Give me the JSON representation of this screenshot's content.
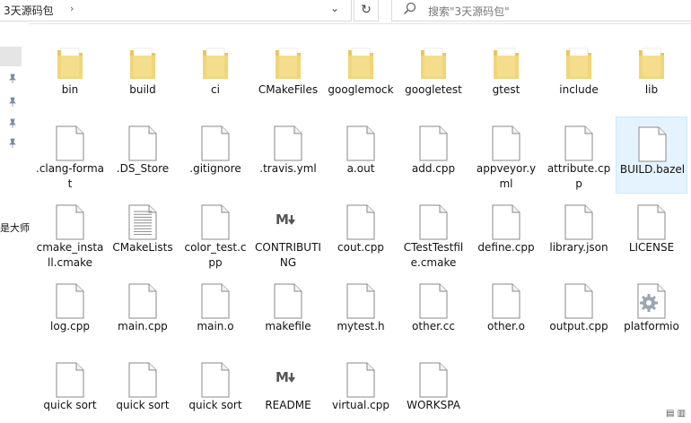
{
  "address_bar": {
    "path": "3天源码包",
    "refresh_glyph": "↻"
  },
  "search": {
    "placeholder": "搜索\"3天源码包\""
  },
  "nav": {
    "partial_label": "是大师"
  },
  "corner": "▤ ▥",
  "items": [
    {
      "name": "bin",
      "type": "folder",
      "icon": "folder-icon"
    },
    {
      "name": "build",
      "type": "folder",
      "icon": "folder-icon"
    },
    {
      "name": "ci",
      "type": "folder",
      "icon": "folder-icon"
    },
    {
      "name": "CMakeFiles",
      "type": "folder",
      "icon": "folder-icon"
    },
    {
      "name": "googlemock",
      "type": "folder",
      "icon": "folder-icon"
    },
    {
      "name": "googletest",
      "type": "folder",
      "icon": "folder-icon"
    },
    {
      "name": "gtest",
      "type": "folder",
      "icon": "folder-icon"
    },
    {
      "name": "include",
      "type": "folder",
      "icon": "folder-icon"
    },
    {
      "name": "lib",
      "type": "folder",
      "icon": "folder-icon"
    },
    {
      "name": ".clang-format",
      "type": "file",
      "icon": "file-icon"
    },
    {
      "name": ".DS_Store",
      "type": "file",
      "icon": "file-icon"
    },
    {
      "name": ".gitignore",
      "type": "file",
      "icon": "file-icon"
    },
    {
      "name": ".travis.yml",
      "type": "file",
      "icon": "file-icon"
    },
    {
      "name": "a.out",
      "type": "file",
      "icon": "file-icon"
    },
    {
      "name": "add.cpp",
      "type": "file",
      "icon": "file-icon"
    },
    {
      "name": "appveyor.yml",
      "type": "file",
      "icon": "file-icon"
    },
    {
      "name": "attribute.cpp",
      "type": "file",
      "icon": "file-icon"
    },
    {
      "name": "BUILD.bazel",
      "type": "file",
      "icon": "file-icon",
      "selected": true
    },
    {
      "name": "cmake_install.cmake",
      "type": "file",
      "icon": "file-icon"
    },
    {
      "name": "CMakeLists",
      "type": "text",
      "icon": "text-file-icon"
    },
    {
      "name": "color_test.cpp",
      "type": "file",
      "icon": "file-icon"
    },
    {
      "name": "CONTRIBUTING",
      "type": "markdown",
      "icon": "markdown-icon"
    },
    {
      "name": "cout.cpp",
      "type": "file",
      "icon": "file-icon"
    },
    {
      "name": "CTestTestfile.cmake",
      "type": "file",
      "icon": "file-icon"
    },
    {
      "name": "define.cpp",
      "type": "file",
      "icon": "file-icon"
    },
    {
      "name": "library.json",
      "type": "file",
      "icon": "file-icon"
    },
    {
      "name": "LICENSE",
      "type": "file",
      "icon": "file-icon"
    },
    {
      "name": "log.cpp",
      "type": "file",
      "icon": "file-icon"
    },
    {
      "name": "main.cpp",
      "type": "file",
      "icon": "file-icon"
    },
    {
      "name": "main.o",
      "type": "file",
      "icon": "file-icon"
    },
    {
      "name": "makefile",
      "type": "file",
      "icon": "file-icon"
    },
    {
      "name": "mytest.h",
      "type": "file",
      "icon": "file-icon"
    },
    {
      "name": "other.cc",
      "type": "file",
      "icon": "file-icon"
    },
    {
      "name": "other.o",
      "type": "file",
      "icon": "file-icon"
    },
    {
      "name": "output.cpp",
      "type": "file",
      "icon": "file-icon"
    },
    {
      "name": "platformio",
      "type": "settings",
      "icon": "gear-file-icon"
    },
    {
      "name": "quick sort",
      "type": "file",
      "icon": "file-icon"
    },
    {
      "name": "quick sort",
      "type": "file",
      "icon": "file-icon"
    },
    {
      "name": "quick sort",
      "type": "file",
      "icon": "file-icon"
    },
    {
      "name": "README",
      "type": "markdown",
      "icon": "markdown-icon"
    },
    {
      "name": "virtual.cpp",
      "type": "file",
      "icon": "file-icon"
    },
    {
      "name": "WORKSPA",
      "type": "file",
      "icon": "file-icon"
    }
  ]
}
